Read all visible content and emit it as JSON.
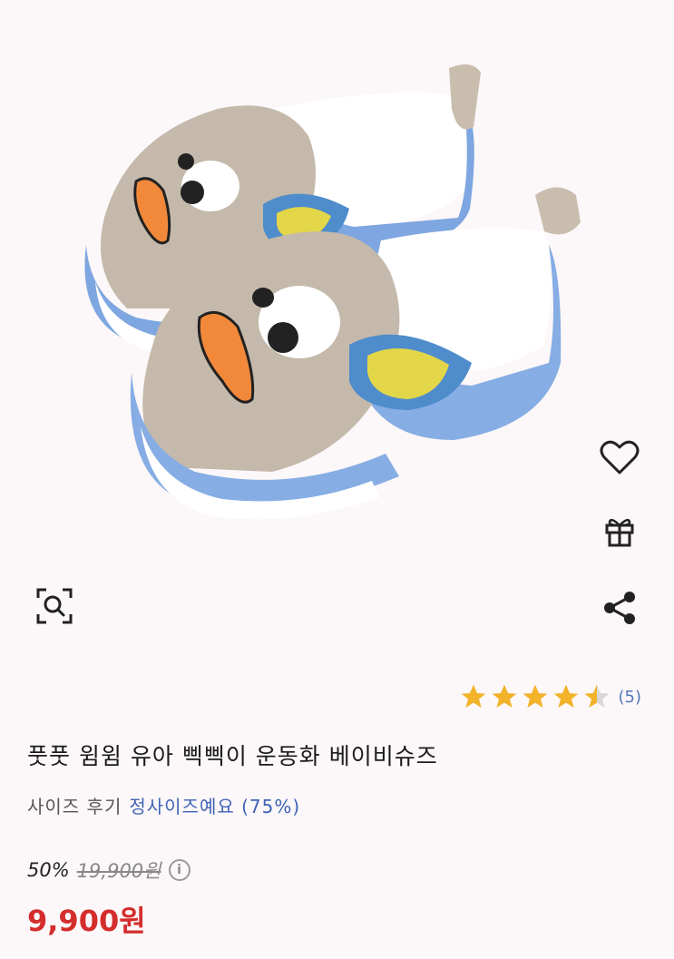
{
  "product": {
    "image_alt": "baby duck shoes",
    "title": "풋풋 윔윔 유아 삑삑이 운동화 베이비슈즈",
    "rating": 4.5,
    "rating_count": "(5)",
    "size_review_label": "사이즈 후기",
    "size_review_value": "정사이즈예요 (75%)",
    "discount": "50%",
    "original_price": "19,900원",
    "sale_price": "9,900원"
  },
  "icons": {
    "wishlist": "heart-icon",
    "gift": "gift-icon",
    "share": "share-icon",
    "zoom": "image-search-icon",
    "info": "info-icon"
  },
  "colors": {
    "accent_price": "#d42d2d",
    "size_value": "#3f63b6",
    "star": "#f2b32b"
  }
}
